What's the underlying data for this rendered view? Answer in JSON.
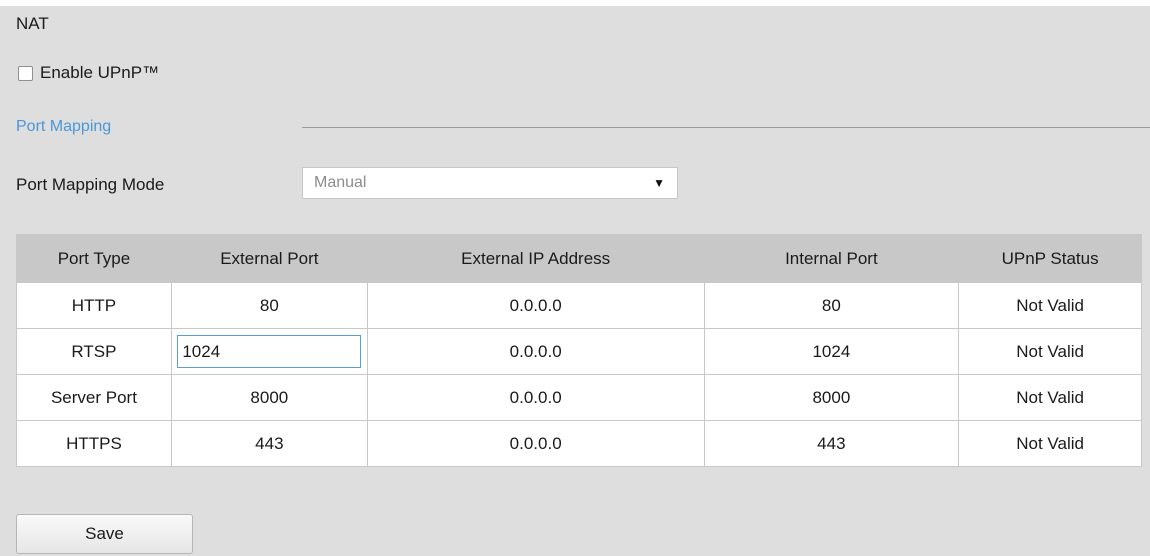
{
  "page": {
    "title": "NAT"
  },
  "upnp": {
    "label": "Enable UPnP™",
    "checked": false
  },
  "port_mapping": {
    "section_title": "Port Mapping",
    "mode_label": "Port Mapping Mode",
    "mode_value": "Manual"
  },
  "table": {
    "headers": [
      "Port Type",
      "External Port",
      "External IP Address",
      "Internal Port",
      "UPnP Status"
    ],
    "rows": [
      {
        "port_type": "HTTP",
        "external_port": "80",
        "external_ip": "0.0.0.0",
        "internal_port": "80",
        "status": "Not Valid"
      },
      {
        "port_type": "RTSP",
        "external_port": "1024",
        "external_ip": "0.0.0.0",
        "internal_port": "1024",
        "status": "Not Valid"
      },
      {
        "port_type": "Server Port",
        "external_port": "8000",
        "external_ip": "0.0.0.0",
        "internal_port": "8000",
        "status": "Not Valid"
      },
      {
        "port_type": "HTTPS",
        "external_port": "443",
        "external_ip": "0.0.0.0",
        "internal_port": "443",
        "status": "Not Valid"
      }
    ]
  },
  "actions": {
    "save_label": "Save"
  },
  "colors": {
    "background": "#dedede",
    "section_title": "#4b97d8",
    "table_header": "#c8c8c8",
    "input_focus_border": "#5a9ed6"
  }
}
